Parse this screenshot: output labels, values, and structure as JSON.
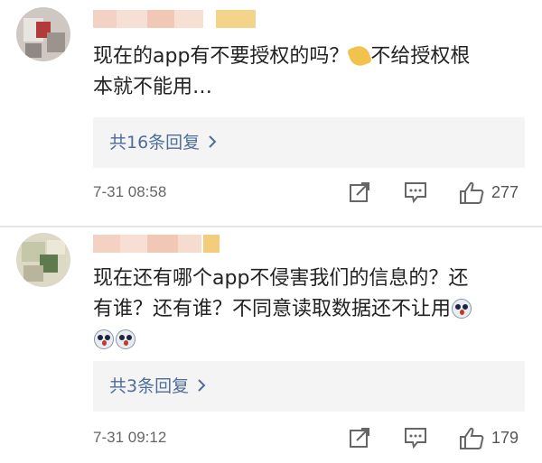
{
  "comments": [
    {
      "text_lines": [
        "现在的app有不要授权的吗？",
        "不给授权根",
        "本就不能用…"
      ],
      "emoji_icon": "pointing-emoji",
      "replies_label": "共16条回复",
      "time": "7-31 08:58",
      "likes": "277"
    },
    {
      "text_lines": [
        "现在还有哪个app不侵害我们的信息的？还",
        "有谁？还有谁？不同意读取数据还不让用"
      ],
      "emoji_icon": "shocked-face-emoji",
      "replies_label": "共3条回复",
      "time": "7-31 09:12",
      "likes": "179"
    }
  ],
  "icons": {
    "repost": "repost-icon",
    "comment": "comment-icon",
    "like": "thumbs-up-icon",
    "chevron": "chevron-right-icon"
  },
  "colors": {
    "link": "#4f6d9a",
    "reply_bg": "#f4f4f4",
    "meta": "#666666"
  }
}
